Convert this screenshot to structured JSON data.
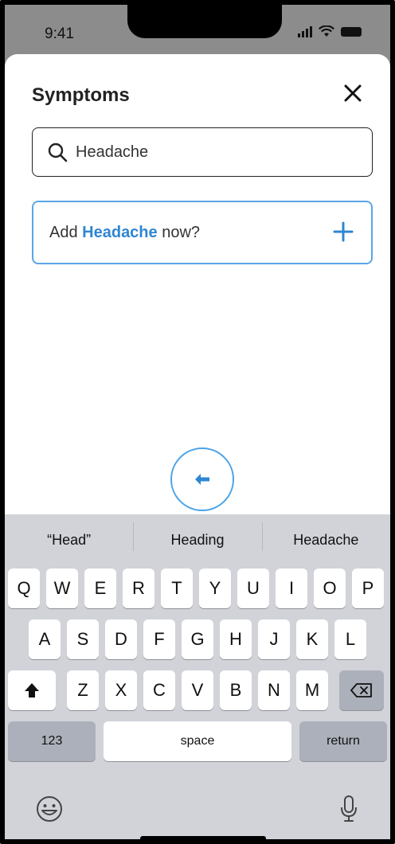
{
  "status": {
    "time": "9:41"
  },
  "header": {
    "title": "Symptoms"
  },
  "search": {
    "value": "Headache"
  },
  "add_card": {
    "prefix": "Add ",
    "term": "Headache",
    "suffix": " now?"
  },
  "suggestions": [
    "“Head”",
    "Heading",
    "Headache"
  ],
  "keyboard": {
    "row1": [
      "Q",
      "W",
      "E",
      "R",
      "T",
      "Y",
      "U",
      "I",
      "O",
      "P"
    ],
    "row2": [
      "A",
      "S",
      "D",
      "F",
      "G",
      "H",
      "J",
      "K",
      "L"
    ],
    "row3": [
      "Z",
      "X",
      "C",
      "V",
      "B",
      "N",
      "M"
    ],
    "numbers_label": "123",
    "space_label": "space",
    "return_label": "return"
  },
  "colors": {
    "accent": "#2f86d1",
    "card_border": "#5aa6e6",
    "keyboard_bg": "#d1d3d9"
  },
  "icons": [
    "close-icon",
    "search-icon",
    "plus-icon",
    "back-arrow-icon",
    "shift-icon",
    "delete-icon",
    "emoji-icon",
    "microphone-icon"
  ]
}
